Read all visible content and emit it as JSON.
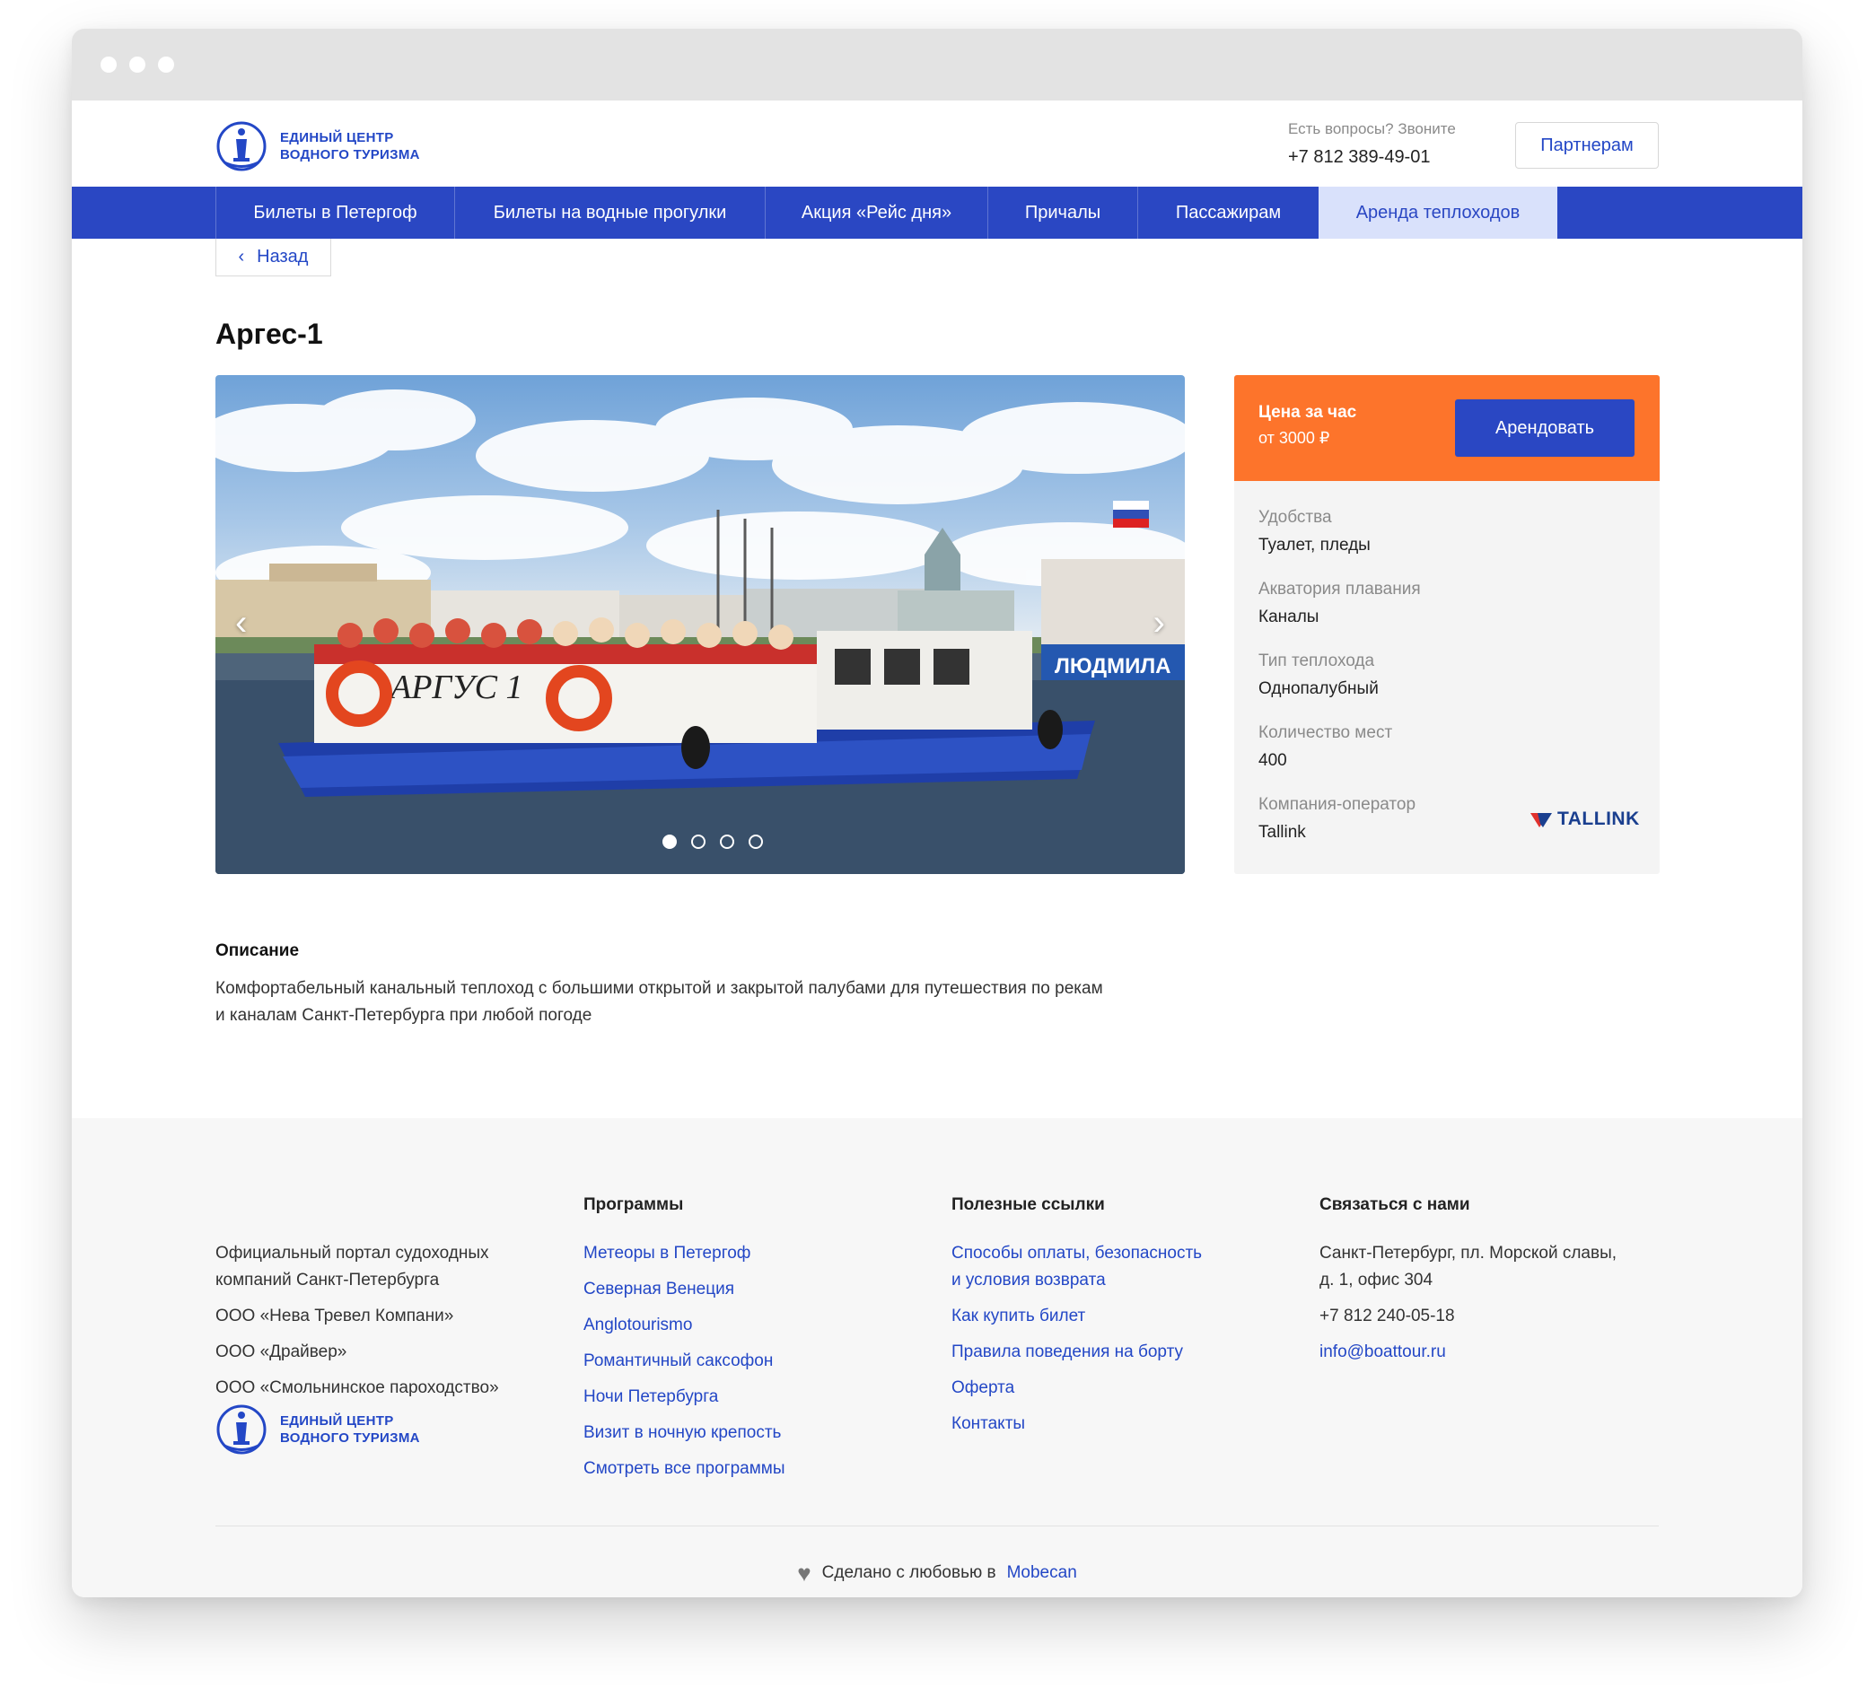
{
  "header": {
    "logo_line1": "ЕДИНЫЙ ЦЕНТР",
    "logo_line2": "ВОДНОГО ТУРИЗМА",
    "contacts_label": "Есть вопросы? Звоните",
    "phone": "+7 812 389-49-01",
    "partners_label": "Партнерам"
  },
  "nav": {
    "items": [
      {
        "label": "Билеты в Петергоф"
      },
      {
        "label": "Билеты на водные прогулки"
      },
      {
        "label": "Акция «Рейс дня»"
      },
      {
        "label": "Причалы"
      },
      {
        "label": "Пассажирам"
      },
      {
        "label": "Аренда теплоходов"
      }
    ],
    "active": "Аренда теплоходов"
  },
  "back_label": "Назад",
  "title": "Аргес-1",
  "gallery": {
    "slides": 4,
    "active_slide": 1,
    "boat_text": "АРГУС 1",
    "other_boat_text": "ЛЮДМИЛА"
  },
  "card": {
    "price_label": "Цена за час",
    "price_value": "от 3000 ₽",
    "rent_label": "Арендовать",
    "specs": [
      {
        "label": "Удобства",
        "value": "Туалет, пледы"
      },
      {
        "label": "Акватория плавания",
        "value": "Каналы"
      },
      {
        "label": "Тип теплохода",
        "value": "Однопалубный"
      },
      {
        "label": "Количество мест",
        "value": "400"
      },
      {
        "label": "Компания-оператор",
        "value": "Tallink"
      }
    ],
    "operator_logo": "TALLINK"
  },
  "description": {
    "title": "Описание",
    "line1": "Комфортабельный канальный теплоход с большими открытой и закрытой палубами для путешествия по рекам",
    "line2": "и каналам Санкт-Петербурга при любой погоде"
  },
  "footer": {
    "about": {
      "line1": "Официальный портал судоходных",
      "line2": "компаний Санкт-Петербурга",
      "companies": [
        "ООО «Нева Тревел Компани»",
        "ООО «Драйвер»",
        "ООО «Смольнинское пароходство»"
      ]
    },
    "programs": {
      "title": "Программы",
      "links": [
        "Метеоры в Петергоф",
        "Северная Венеция",
        "Anglotourismo",
        "Романтичный саксофон",
        "Ночи Петербурга",
        "Визит в ночную крепость",
        "Смотреть все программы"
      ]
    },
    "useful": {
      "title": "Полезные ссылки",
      "link1_line1": "Способы оплаты, безопасность",
      "link1_line2": "и условия возврата",
      "links": [
        "Как купить билет",
        "Правила поведения на борту",
        "Оферта",
        "Контакты"
      ]
    },
    "contact": {
      "title": "Связаться с нами",
      "address_line1": "Санкт-Петербург, пл. Морской славы,",
      "address_line2": "д. 1, офис 304",
      "phone": "+7 812 240-05-18",
      "email": "info@boattour.ru"
    },
    "made_text": "Сделано с любовью в",
    "made_link": "Mobecan"
  },
  "colors": {
    "brand_blue": "#2a47c3",
    "accent_orange": "#fd742b",
    "active_nav_bg": "#d9e1fb"
  }
}
